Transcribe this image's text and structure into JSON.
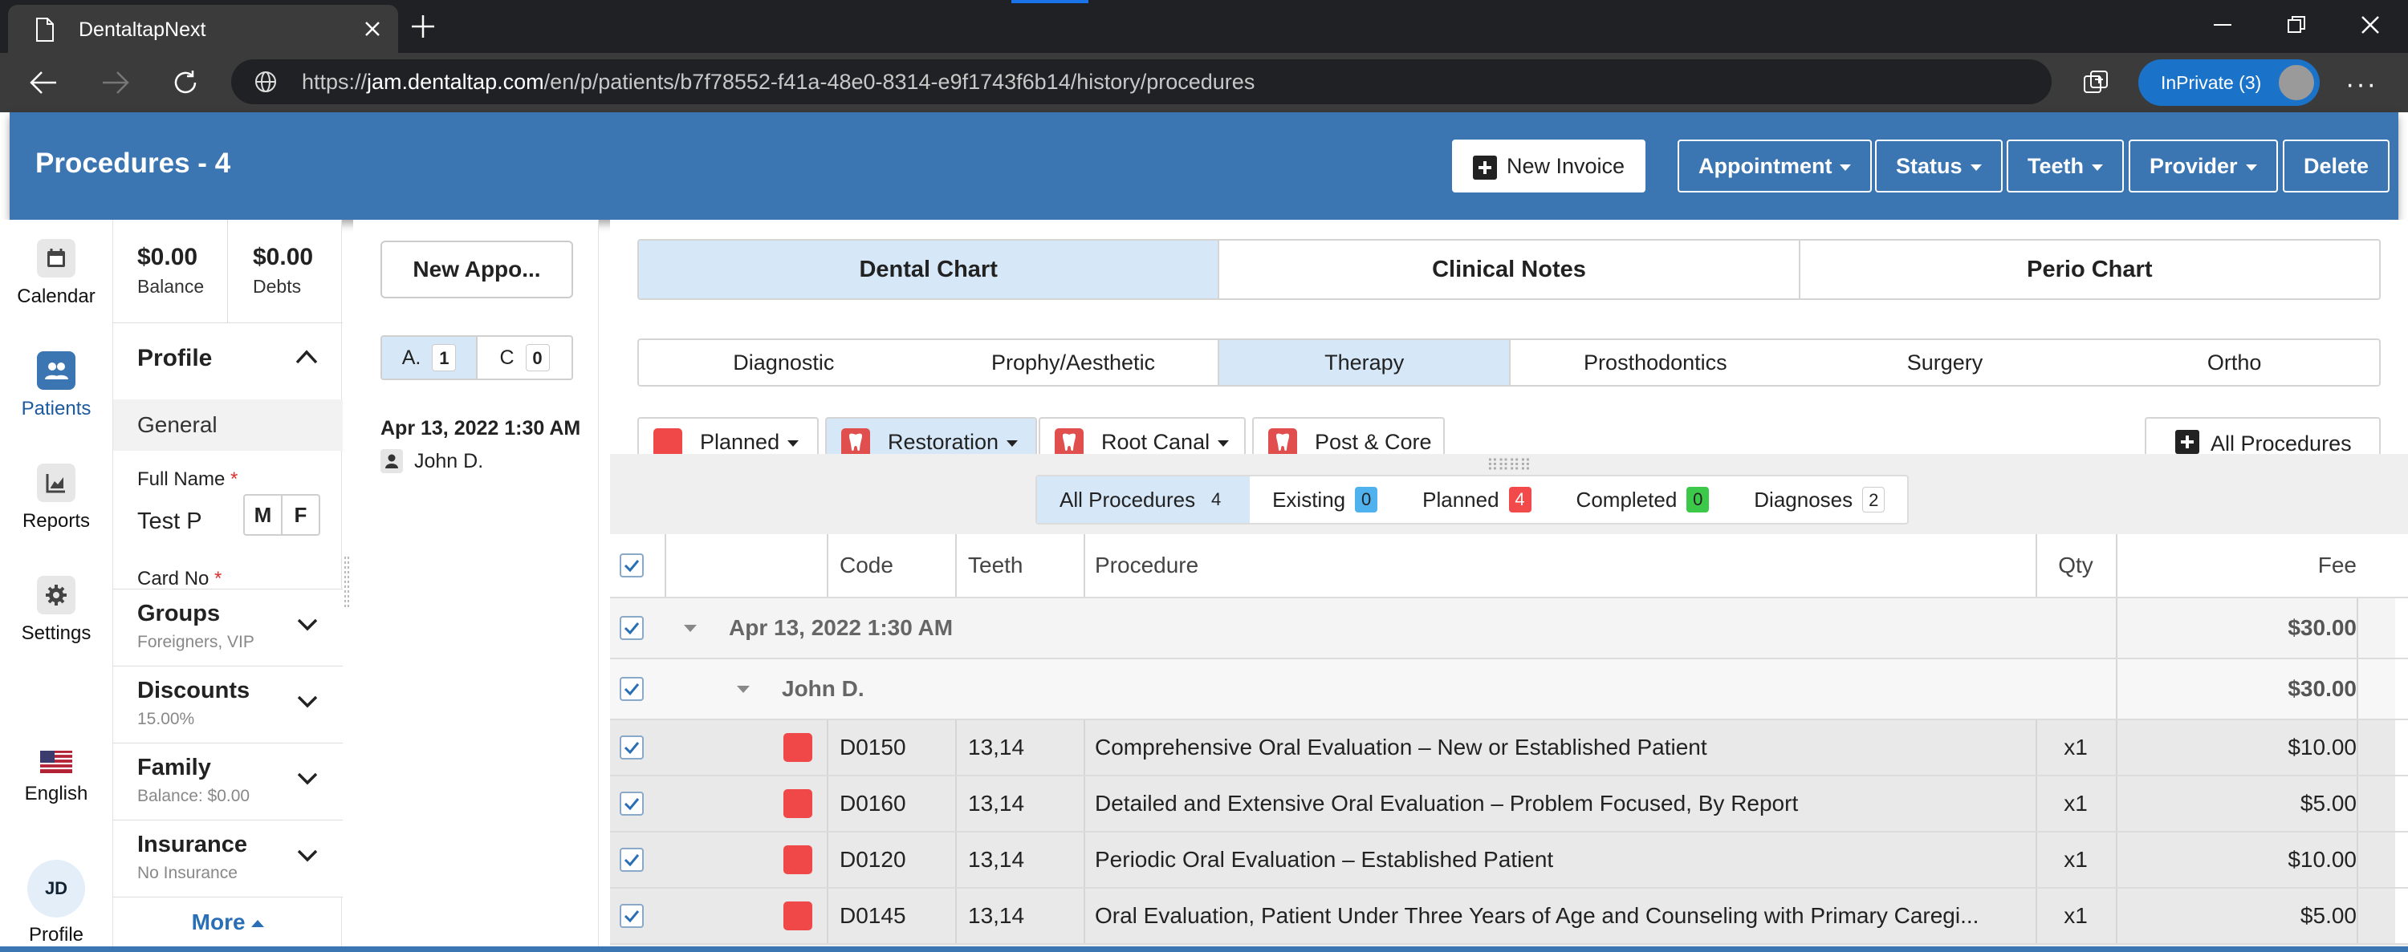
{
  "browser": {
    "tab_title": "DentaltapNext",
    "url_prefix": "https://",
    "url_host": "jam.dentaltap.com",
    "url_path": "/en/p/patients/b7f78552-f41a-48e0-8314-e9f1743f6b14/history/procedures",
    "inprivate_label": "InPrivate (3)"
  },
  "header": {
    "title": "Procedures - 4",
    "buttons": {
      "new_invoice": "New Invoice",
      "appointment": "Appointment",
      "status": "Status",
      "teeth": "Teeth",
      "provider": "Provider",
      "delete": "Delete"
    }
  },
  "leftnav": {
    "items": [
      {
        "label": "Calendar",
        "icon": "calendar-icon"
      },
      {
        "label": "Patients",
        "icon": "patients-icon"
      },
      {
        "label": "Reports",
        "icon": "reports-icon"
      },
      {
        "label": "Settings",
        "icon": "gear-icon"
      },
      {
        "label": "English",
        "icon": "us-flag-icon"
      },
      {
        "label": "Profile",
        "initials": "JD"
      }
    ]
  },
  "profile": {
    "balance_value": "$0.00",
    "balance_label": "Balance",
    "debts_value": "$0.00",
    "debts_label": "Debts",
    "title": "Profile",
    "general": "General",
    "full_name_label": "Full Name",
    "full_name_value": "Test P",
    "sex_m": "M",
    "sex_f": "F",
    "card_no_label": "Card No",
    "required_mark": "*",
    "sections": [
      {
        "title": "Groups",
        "sub": "Foreigners, VIP"
      },
      {
        "title": "Discounts",
        "sub": "15.00%"
      },
      {
        "title": "Family",
        "sub": "Balance: $0.00"
      },
      {
        "title": "Insurance",
        "sub": "No Insurance"
      }
    ],
    "more": "More"
  },
  "appointments": {
    "new_button": "New Appo...",
    "tab_a": "A.",
    "tab_a_count": "1",
    "tab_c": "C",
    "tab_c_count": "0",
    "entry_time": "Apr 13, 2022 1:30 AM",
    "entry_provider": "John D."
  },
  "main": {
    "tabs": [
      "Dental Chart",
      "Clinical Notes",
      "Perio Chart"
    ],
    "active_tab": "Dental Chart",
    "categories": [
      "Diagnostic",
      "Prophy/Aesthetic",
      "Therapy",
      "Prosthodontics",
      "Surgery",
      "Ortho"
    ],
    "active_category": "Therapy",
    "tools": {
      "planned": "Planned",
      "restoration": "Restoration",
      "root_canal": "Root Canal",
      "post_core": "Post & Core",
      "all_procedures": "All Procedures"
    },
    "filters": [
      {
        "label": "All Procedures",
        "count": "4",
        "style": "plain"
      },
      {
        "label": "Existing",
        "count": "0",
        "style": "blue"
      },
      {
        "label": "Planned",
        "count": "4",
        "style": "red"
      },
      {
        "label": "Completed",
        "count": "0",
        "style": "green"
      },
      {
        "label": "Diagnoses",
        "count": "2",
        "style": "plain"
      }
    ],
    "table": {
      "headers": {
        "code": "Code",
        "teeth": "Teeth",
        "procedure": "Procedure",
        "qty": "Qty",
        "fee": "Fee"
      },
      "date_group": {
        "label": "Apr 13, 2022 1:30 AM",
        "fee": "$30.00"
      },
      "provider_group": {
        "label": "John D.",
        "fee": "$30.00"
      },
      "rows": [
        {
          "code": "D0150",
          "teeth": "13,14",
          "procedure": "Comprehensive Oral Evaluation – New or Established Patient",
          "qty": "x1",
          "fee": "$10.00"
        },
        {
          "code": "D0160",
          "teeth": "13,14",
          "procedure": "Detailed and Extensive Oral Evaluation – Problem Focused, By Report",
          "qty": "x1",
          "fee": "$5.00"
        },
        {
          "code": "D0120",
          "teeth": "13,14",
          "procedure": "Periodic Oral Evaluation – Established Patient",
          "qty": "x1",
          "fee": "$10.00"
        },
        {
          "code": "D0145",
          "teeth": "13,14",
          "procedure": "Oral Evaluation, Patient Under Three Years of Age and Counseling with Primary Caregi...",
          "qty": "x1",
          "fee": "$5.00"
        }
      ]
    }
  },
  "colors": {
    "brand_blue": "#3b76b2",
    "active_tab": "#d6e8f8",
    "planned_red": "#f04848"
  }
}
